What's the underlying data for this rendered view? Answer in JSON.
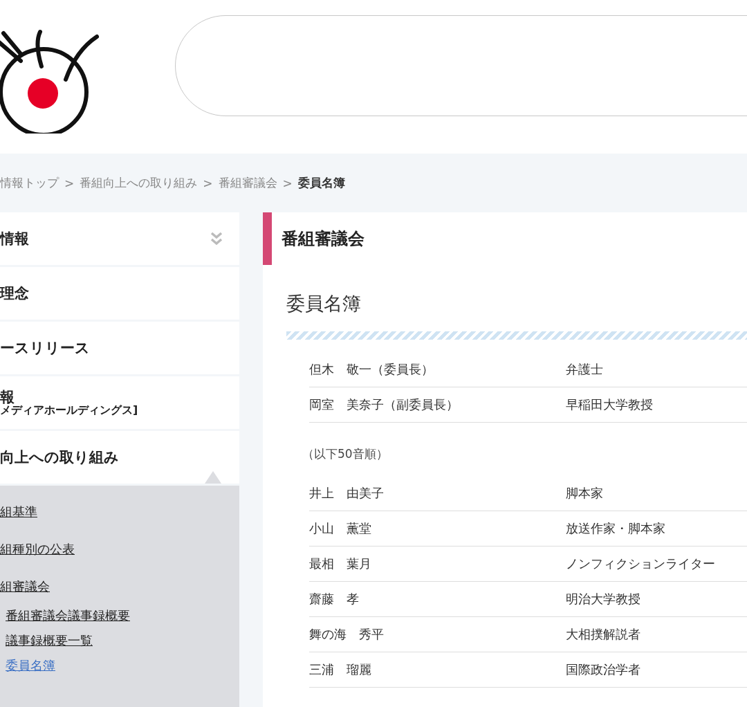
{
  "breadcrumb": [
    {
      "label": "情報トップ",
      "current": false
    },
    {
      "separator": ">",
      "label": "番組向上への取り組み",
      "current": false
    },
    {
      "separator": ">",
      "label": "番組審議会",
      "current": false
    },
    {
      "separator": ">",
      "label": "委員名簿",
      "current": true
    }
  ],
  "sidebar": {
    "items": [
      {
        "kind": "toggle",
        "lines": [
          "情報"
        ],
        "expanded": false
      },
      {
        "kind": "link",
        "lines": [
          "理念"
        ],
        "expanded": false
      },
      {
        "kind": "link",
        "lines": [
          "ースリリース"
        ],
        "expanded": false
      },
      {
        "kind": "link",
        "lines": [
          "報",
          "メディアホールディングス]"
        ],
        "expanded": false
      },
      {
        "kind": "link",
        "lines": [
          "向上への取り組み"
        ],
        "expanded": true,
        "children": [
          {
            "label": "組基準",
            "selected": false
          },
          {
            "label": "組種別の公表",
            "selected": false
          },
          {
            "label": "組審議会",
            "selected": false,
            "children": [
              {
                "label": "番組審議会議事録概要",
                "selected": false
              },
              {
                "label": "議事録概要一覧",
                "selected": false
              },
              {
                "label": "委員名簿",
                "selected": true
              }
            ]
          }
        ]
      }
    ]
  },
  "content": {
    "section_title": "番組審議会",
    "page_title": "委員名簿",
    "groups": [
      {
        "rows": [
          {
            "name": "但木　敬一（委員長）",
            "role": "弁護士"
          },
          {
            "name": "岡室　美奈子（副委員長）",
            "role": "早稲田大学教授"
          }
        ]
      },
      {
        "note": "（以下50音順）",
        "rows": [
          {
            "name": "井上　由美子",
            "role": "脚本家"
          },
          {
            "name": "小山　薫堂",
            "role": "放送作家・脚本家"
          },
          {
            "name": "最相　葉月",
            "role": "ノンフィクションライター"
          },
          {
            "name": "齋藤　孝",
            "role": "明治大学教授"
          },
          {
            "name": "舞の海　秀平",
            "role": "大相撲解説者"
          },
          {
            "name": "三浦　瑠麗",
            "role": "国際政治学者"
          }
        ]
      }
    ]
  }
}
